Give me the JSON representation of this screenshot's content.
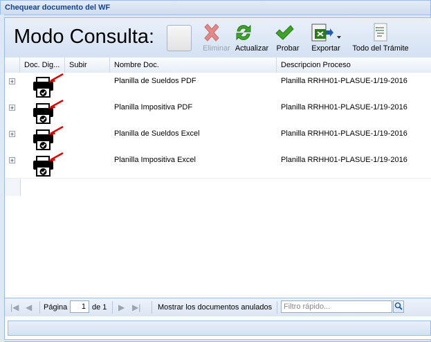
{
  "window": {
    "title": "Chequear documento del WF"
  },
  "toolbar": {
    "mode_title": "Modo Consulta:",
    "buttons": [
      {
        "label": "Eliminar",
        "icon": "delete-x-icon",
        "disabled": true
      },
      {
        "label": "Actualizar",
        "icon": "refresh-icon"
      },
      {
        "label": "Probar",
        "icon": "check-icon"
      },
      {
        "label": "Exportar",
        "icon": "export-icon"
      },
      {
        "label": "Todo del Trámite",
        "icon": "document-list-icon"
      }
    ]
  },
  "grid": {
    "columns": [
      "Doc. Dig...",
      "Subir",
      "Nombre Doc.",
      "Descripcion Proceso"
    ],
    "rows": [
      {
        "nombre": "Planilla de Sueldos PDF",
        "descripcion": "Planilla RRHH01-PLASUE-1/19-2016"
      },
      {
        "nombre": "Planilla Impositiva PDF",
        "descripcion": "Planilla RRHH01-PLASUE-1/19-2016"
      },
      {
        "nombre": "Planilla de Sueldos Excel",
        "descripcion": "Planilla RRHH01-PLASUE-1/19-2016"
      },
      {
        "nombre": "Planilla Impositiva Excel",
        "descripcion": "Planilla RRHH01-PLASUE-1/19-2016"
      }
    ],
    "expander_symbol": "+"
  },
  "pager": {
    "page_label": "Página",
    "page_value": "1",
    "of_label": "de 1",
    "show_annulled": "Mostrar los documentos anulados",
    "quick_filter_placeholder": "Filtro rápido..."
  },
  "colors": {
    "accent": "#15428b",
    "border": "#99bbe8",
    "arrow": "#e00000"
  }
}
